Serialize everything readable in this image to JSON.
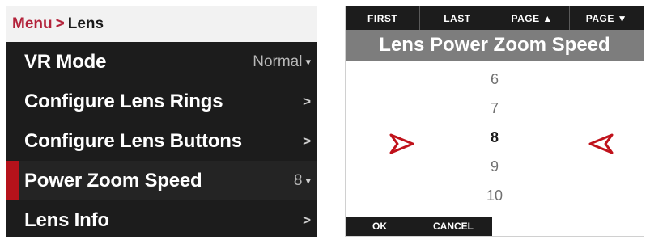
{
  "menu": {
    "breadcrumb": {
      "root": "Menu",
      "separator": ">",
      "current": "Lens"
    },
    "items": [
      {
        "label": "VR Mode",
        "value": "Normal",
        "indicator": "▾"
      },
      {
        "label": "Configure Lens Rings",
        "value": "",
        "indicator": ">"
      },
      {
        "label": "Configure Lens Buttons",
        "value": "",
        "indicator": ">"
      },
      {
        "label": "Power Zoom Speed",
        "value": "8",
        "indicator": "▾"
      },
      {
        "label": "Lens Info",
        "value": "",
        "indicator": ">"
      }
    ],
    "selected_index": 3
  },
  "picker": {
    "nav": {
      "first": "FIRST",
      "last": "LAST",
      "page_up": "PAGE ▲",
      "page_down": "PAGE ▼"
    },
    "title": "Lens Power Zoom Speed",
    "values": [
      "6",
      "7",
      "8",
      "9",
      "10"
    ],
    "current_value": "8",
    "ok_label": "OK",
    "cancel_label": "CANCEL"
  },
  "colors": {
    "accent_red": "#b5121b",
    "panel_dark": "#1c1c1c",
    "title_gray": "#7d7d7d"
  },
  "icons": {
    "menu_arrow": "chevron-right-icon",
    "dropdown": "caret-down-icon",
    "picker_left": "triangle-pointer-right-icon",
    "picker_right": "triangle-pointer-left-icon"
  }
}
